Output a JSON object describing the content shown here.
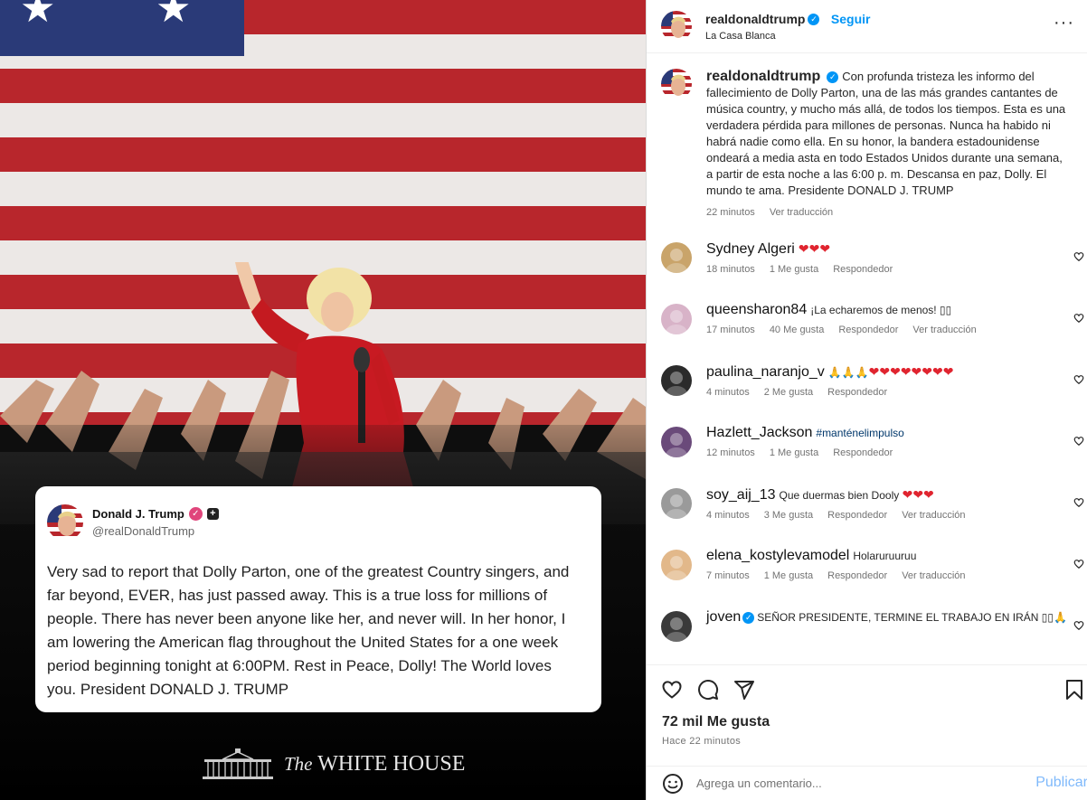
{
  "media": {
    "tweet": {
      "name": "Donald J. Trump",
      "handle": "@realDonaldTrump",
      "text": "Very sad to report that Dolly Parton, one of the greatest Country singers, and far beyond, EVER, has just passed away. This is a true loss for millions of people. There has never been anyone like her, and never will. In her honor, I am lowering the American flag throughout the United States for a one week period beginning tonight at 6:00PM. Rest in Peace, Dolly! The World loves you. President DONALD J. TRUMP"
    },
    "footer": {
      "the": "The",
      "name": "WHITE HOUSE"
    }
  },
  "header": {
    "username": "realdonaldtrump",
    "follow": "Seguir",
    "location": "La Casa Blanca",
    "more": "···"
  },
  "caption": {
    "username": "realdonaldtrump",
    "text": "Con profunda tristeza les informo del fallecimiento de Dolly Parton, una de las más grandes cantantes de música country, y mucho más allá, de todos los tiempos. Esta es una verdadera pérdida para millones de personas. Nunca ha habido ni habrá nadie como ella. En su honor, la bandera estadounidense ondeará a media asta en todo Estados Unidos durante una semana, a partir de esta noche a las 6:00 p. m. Descansa en paz, Dolly. El mundo te ama. Presidente DONALD J. TRUMP",
    "time": "22 minutos",
    "translate": "Ver traducción"
  },
  "comments": [
    {
      "user": "Sydney Algeri",
      "text": "❤❤❤",
      "time": "18 minutos",
      "likes": "1 Me gusta",
      "reply": "Respondedor",
      "translate": "",
      "avatarColor": "#c9a46a"
    },
    {
      "user": "queensharon84",
      "text": "¡La echaremos de menos! ▯▯",
      "time": "17 minutos",
      "likes": "40 Me gusta",
      "reply": "Respondedor",
      "translate": "Ver traducción",
      "avatarColor": "#d8b3c8"
    },
    {
      "user": "paulina_naranjo_v",
      "text": "🙏🙏🙏❤❤❤❤❤❤❤❤",
      "time": "4 minutos",
      "likes": "2 Me gusta",
      "reply": "Respondedor",
      "translate": "",
      "avatarColor": "#2b2b2b"
    },
    {
      "user": "Hazlett_Jackson",
      "text": "#manténelimpulso",
      "time": "12 minutos",
      "likes": "1 Me gusta",
      "reply": "Respondedor",
      "translate": "",
      "avatarColor": "#6a4a7a"
    },
    {
      "user": "soy_aij_13",
      "text": "Que duermas bien Dooly ❤❤❤",
      "time": "4 minutos",
      "likes": "3 Me gusta",
      "reply": "Respondedor",
      "translate": "Ver traducción",
      "avatarColor": "#9a9a9a"
    },
    {
      "user": "elena_kostylevamodel",
      "text": "Holaruruuruu",
      "time": "7 minutos",
      "likes": "1 Me gusta",
      "reply": "Respondedor",
      "translate": "Ver traducción",
      "avatarColor": "#e2b88a"
    },
    {
      "user": "joven",
      "text": "SEÑOR PRESIDENTE, TERMINE EL TRABAJO EN IRÁN ▯▯🙏",
      "time": "",
      "likes": "",
      "reply": "",
      "translate": "",
      "avatarColor": "#3a3a3a"
    }
  ],
  "footer": {
    "likes": "72 mil Me gusta",
    "ago": "Hace 22 minutos",
    "comment_placeholder": "Agrega un comentario...",
    "publish": "Publicar"
  },
  "colors": {
    "accent": "#0095f6",
    "flag_red": "#b8262c",
    "flag_blue": "#2a3a78"
  }
}
